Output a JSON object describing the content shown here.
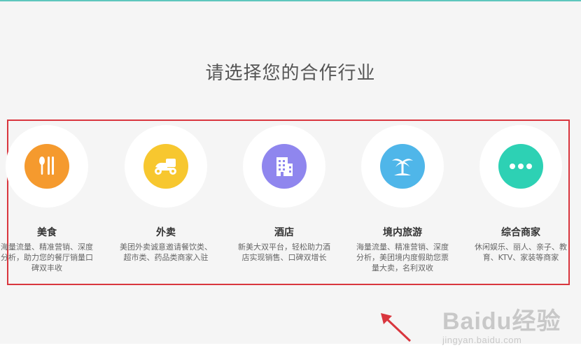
{
  "page": {
    "title": "请选择您的合作行业"
  },
  "industries": [
    {
      "name": "美食",
      "desc": "海量流量、精准营销、深度分析，助力您的餐厅销量口碑双丰收",
      "icon": "utensils-icon",
      "color": "#f59a2e"
    },
    {
      "name": "外卖",
      "desc": "美团外卖诚意邀请餐饮类、超市类、药品类商家入驻",
      "icon": "scooter-icon",
      "color": "#f7c72f"
    },
    {
      "name": "酒店",
      "desc": "新美大双平台，轻松助力酒店实现销售、口碑双增长",
      "icon": "building-icon",
      "color": "#8f86ee"
    },
    {
      "name": "境内旅游",
      "desc": "海量流量、精准营销、深度分析，美团境内度假助您票量大卖，名利双收",
      "icon": "palm-tree-icon",
      "color": "#4fb6e9"
    },
    {
      "name": "综合商家",
      "desc": "休闲娱乐、丽人、亲子、教育、KTV、家装等商家",
      "icon": "more-dots-icon",
      "color": "#2dd1b4"
    }
  ],
  "watermark": {
    "main": "Baidu经验",
    "sub": "jingyan.baidu.com"
  },
  "colors": {
    "highlight_border": "#d9363e",
    "arrow": "#d9363e"
  }
}
